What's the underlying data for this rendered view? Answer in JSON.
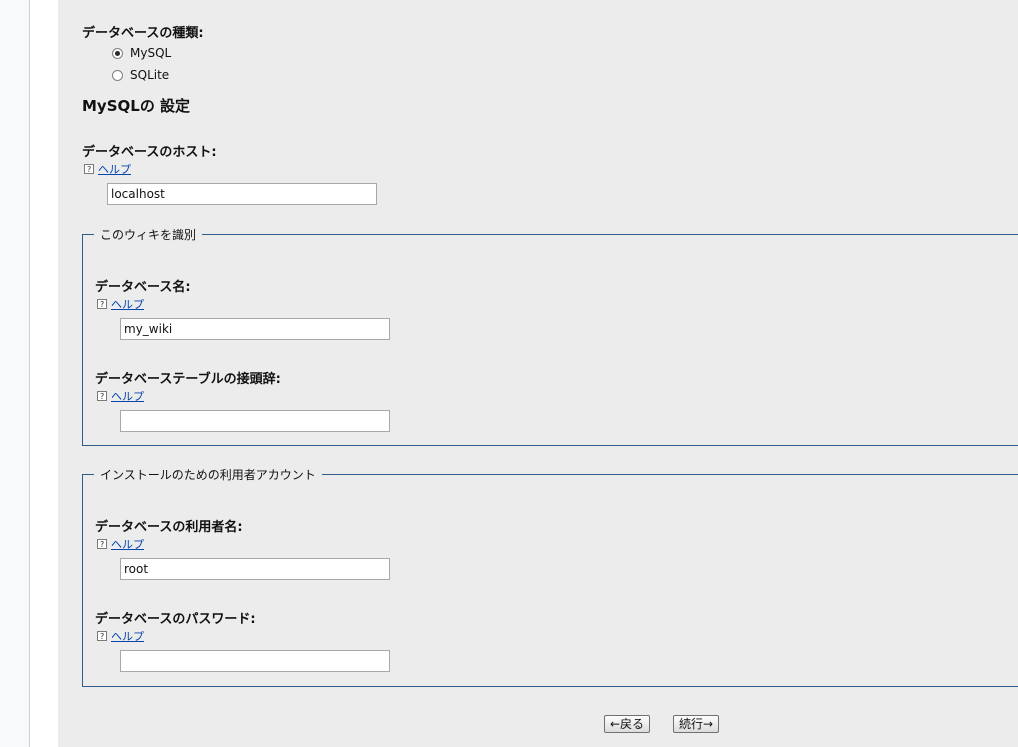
{
  "db_type": {
    "label": "データベースの種類:",
    "options": [
      {
        "label": "MySQL",
        "selected": true
      },
      {
        "label": "SQLite",
        "selected": false
      }
    ]
  },
  "mysql_heading": "MySQLの 設定",
  "db_host": {
    "label": "データベースのホスト:",
    "help": "ヘルプ",
    "value": "localhost"
  },
  "identify_wiki": {
    "legend": "このウィキを識別",
    "db_name": {
      "label": "データベース名:",
      "help": "ヘルプ",
      "value": "my_wiki"
    },
    "table_prefix": {
      "label": "データベーステーブルの接頭辞:",
      "help": "ヘルプ",
      "value": ""
    }
  },
  "install_account": {
    "legend": "インストールのための利用者アカウント",
    "db_user": {
      "label": "データベースの利用者名:",
      "help": "ヘルプ",
      "value": "root"
    },
    "db_password": {
      "label": "データベースのパスワード:",
      "help": "ヘルプ",
      "value": ""
    }
  },
  "buttons": {
    "back": "←戻る",
    "continue": "続行→"
  },
  "colors": {
    "fieldset_border": "#2f5d8a",
    "link": "#0645ad",
    "panel_bg": "#ececec"
  },
  "icons": {
    "help": "help-question-icon"
  }
}
